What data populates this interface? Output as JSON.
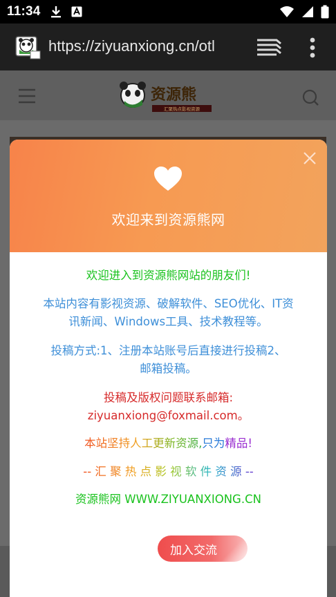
{
  "status_bar": {
    "time": "11:34"
  },
  "browser": {
    "url": "https://ziyuanxiong.cn/otl"
  },
  "site": {
    "logo_text": "资源熊",
    "logo_tagline": "汇聚热点影视资源"
  },
  "modal": {
    "title": "欢迎来到资源熊网",
    "welcome": "欢迎进入到资源熊网站的朋友们!",
    "content_line1": "本站内容有影视资源、破解软件、SEO优化、IT资",
    "content_line2": "讯新闻、Windows工具、技术教程等。",
    "submit_line1": "投稿方式:1、注册本站账号后直接进行投稿2、",
    "submit_line2": "邮箱投稿。",
    "contact_label": "投稿及版权问题联系邮箱:",
    "contact_email": "ziyuanxiong@foxmail.com。",
    "slogan_part1": "本站坚持人工更新资源,",
    "slogan_part2": "只为",
    "slogan_part3": "精品!",
    "tagline": "-- 汇 聚 热 点 影 视 软 件 资 源 --",
    "site_line": "资源熊网 WWW.ZIYUANXIONG.CN",
    "join_button": "加入交流"
  },
  "colors": {
    "welcome": "#19c21d",
    "content": "#3e8fd8",
    "contact": "#d62a2a",
    "site_line": "#19c21d",
    "header_start": "#f7834a",
    "header_end": "#f2a35c"
  }
}
